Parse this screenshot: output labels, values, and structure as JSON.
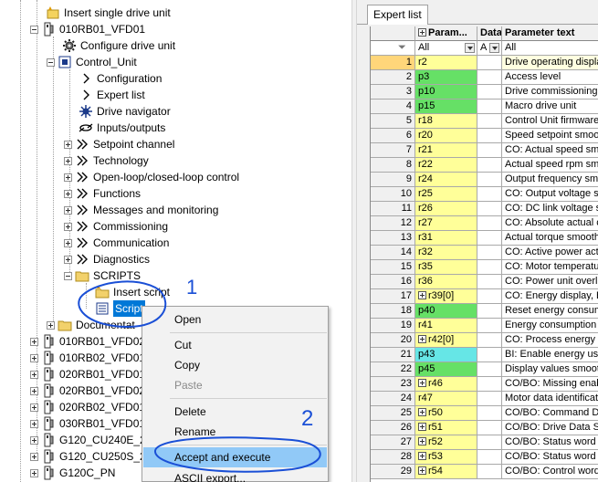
{
  "tree": {
    "items": [
      {
        "label": "Insert single drive unit",
        "icon": "insert-star-icon"
      },
      {
        "label": "010RB01_VFD01",
        "icon": "drive-unit-icon"
      },
      {
        "label": "Configure drive unit",
        "icon": "configure-gear-icon"
      },
      {
        "label": "Control_Unit",
        "icon": "control-unit-icon"
      },
      {
        "label": "Configuration",
        "icon": "chevron-right-icon"
      },
      {
        "label": "Expert list",
        "icon": "chevron-right-icon"
      },
      {
        "label": "Drive navigator",
        "icon": "drive-navigator-icon"
      },
      {
        "label": "Inputs/outputs",
        "icon": "inputs-outputs-icon"
      },
      {
        "label": "Setpoint channel",
        "icon": "double-chevron-icon"
      },
      {
        "label": "Technology",
        "icon": "double-chevron-icon"
      },
      {
        "label": "Open-loop/closed-loop control",
        "icon": "double-chevron-icon"
      },
      {
        "label": "Functions",
        "icon": "double-chevron-icon"
      },
      {
        "label": "Messages and monitoring",
        "icon": "double-chevron-icon"
      },
      {
        "label": "Commissioning",
        "icon": "double-chevron-icon"
      },
      {
        "label": "Communication",
        "icon": "double-chevron-icon"
      },
      {
        "label": "Diagnostics",
        "icon": "double-chevron-icon"
      },
      {
        "label": "SCRIPTS",
        "icon": "folder-icon"
      },
      {
        "label": "Insert script",
        "icon": "insert-folder-icon"
      },
      {
        "label": "Script",
        "icon": "script-icon"
      },
      {
        "label": "Documentat",
        "icon": "folder-icon"
      },
      {
        "label": "010RB01_VFD02",
        "icon": "drive-unit-icon"
      },
      {
        "label": "010RB02_VFD01",
        "icon": "drive-unit-icon"
      },
      {
        "label": "020RB01_VFD01",
        "icon": "drive-unit-icon"
      },
      {
        "label": "020RB01_VFD02",
        "icon": "drive-unit-icon"
      },
      {
        "label": "020RB02_VFD01",
        "icon": "drive-unit-icon"
      },
      {
        "label": "030RB01_VFD01",
        "icon": "drive-unit-icon"
      },
      {
        "label": "G120_CU240E_2",
        "icon": "drive-unit-icon"
      },
      {
        "label": "G120_CU250S_2",
        "icon": "drive-unit-icon"
      },
      {
        "label": "G120C_PN",
        "icon": "drive-unit-icon"
      }
    ]
  },
  "context_menu": {
    "items": [
      {
        "label": "Open",
        "disabled": false
      },
      {
        "label": "Cut",
        "disabled": false
      },
      {
        "label": "Copy",
        "disabled": false
      },
      {
        "label": "Paste",
        "disabled": true
      },
      {
        "label": "Delete",
        "disabled": false
      },
      {
        "label": "Rename",
        "disabled": false
      },
      {
        "label": "Accept and execute",
        "disabled": false,
        "highlighted": true
      },
      {
        "label": "ASCII export...",
        "disabled": false
      }
    ]
  },
  "annotations": {
    "one": "1",
    "two": "2"
  },
  "expert_list": {
    "tab_label": "Expert list",
    "headers": {
      "param": "Param...",
      "data": "Data",
      "text": "Parameter text"
    },
    "filter": {
      "param": "All",
      "data": "A",
      "text": "All"
    },
    "rows": [
      {
        "n": "1",
        "p": "r2",
        "t": "Drive operating displa",
        "c": "yellow",
        "sel": true
      },
      {
        "n": "2",
        "p": "p3",
        "t": "Access level",
        "c": "green"
      },
      {
        "n": "3",
        "p": "p10",
        "t": "Drive commissioning p",
        "c": "green"
      },
      {
        "n": "4",
        "p": "p15",
        "t": "Macro drive unit",
        "c": "green"
      },
      {
        "n": "5",
        "p": "r18",
        "t": "Control Unit firmware",
        "c": "yellow"
      },
      {
        "n": "6",
        "p": "r20",
        "t": "Speed setpoint smoot",
        "c": "yellow"
      },
      {
        "n": "7",
        "p": "r21",
        "t": "CO: Actual speed smo",
        "c": "yellow"
      },
      {
        "n": "8",
        "p": "r22",
        "t": "Actual speed rpm smo",
        "c": "yellow"
      },
      {
        "n": "9",
        "p": "r24",
        "t": "Output frequency smo",
        "c": "yellow"
      },
      {
        "n": "10",
        "p": "r25",
        "t": "CO: Output voltage sm",
        "c": "yellow"
      },
      {
        "n": "11",
        "p": "r26",
        "t": "CO: DC link voltage sm",
        "c": "yellow"
      },
      {
        "n": "12",
        "p": "r27",
        "t": "CO: Absolute actual c",
        "c": "yellow"
      },
      {
        "n": "13",
        "p": "r31",
        "t": "Actual torque smoothe",
        "c": "yellow"
      },
      {
        "n": "14",
        "p": "r32",
        "t": "CO: Active power act",
        "c": "yellow"
      },
      {
        "n": "15",
        "p": "r35",
        "t": "CO: Motor temperatur",
        "c": "yellow"
      },
      {
        "n": "16",
        "p": "r36",
        "t": "CO: Power unit overlo",
        "c": "yellow"
      },
      {
        "n": "17",
        "p": "r39[0]",
        "t": "CO: Energy display, E",
        "c": "yellow",
        "exp": true
      },
      {
        "n": "18",
        "p": "p40",
        "t": "Reset energy consum",
        "c": "green"
      },
      {
        "n": "19",
        "p": "r41",
        "t": "Energy consumption s",
        "c": "yellow"
      },
      {
        "n": "20",
        "p": "r42[0]",
        "t": "CO: Process energy c",
        "c": "yellow",
        "exp": true
      },
      {
        "n": "21",
        "p": "p43",
        "t": "BI: Enable energy usa",
        "c": "cyan"
      },
      {
        "n": "22",
        "p": "p45",
        "t": "Display values smooth",
        "c": "green"
      },
      {
        "n": "23",
        "p": "r46",
        "t": "CO/BO: Missing enabl",
        "c": "yellow",
        "exp": true
      },
      {
        "n": "24",
        "p": "r47",
        "t": "Motor data identificat",
        "c": "yellow"
      },
      {
        "n": "25",
        "p": "r50",
        "t": "CO/BO: Command Dat",
        "c": "yellow",
        "exp": true
      },
      {
        "n": "26",
        "p": "r51",
        "t": "CO/BO: Drive Data Se",
        "c": "yellow",
        "exp": true
      },
      {
        "n": "27",
        "p": "r52",
        "t": "CO/BO: Status word 1",
        "c": "yellow",
        "exp": true
      },
      {
        "n": "28",
        "p": "r53",
        "t": "CO/BO: Status word 2",
        "c": "yellow",
        "exp": true
      },
      {
        "n": "29",
        "p": "r54",
        "t": "CO/BO: Control word",
        "c": "yellow",
        "exp": true
      }
    ]
  }
}
